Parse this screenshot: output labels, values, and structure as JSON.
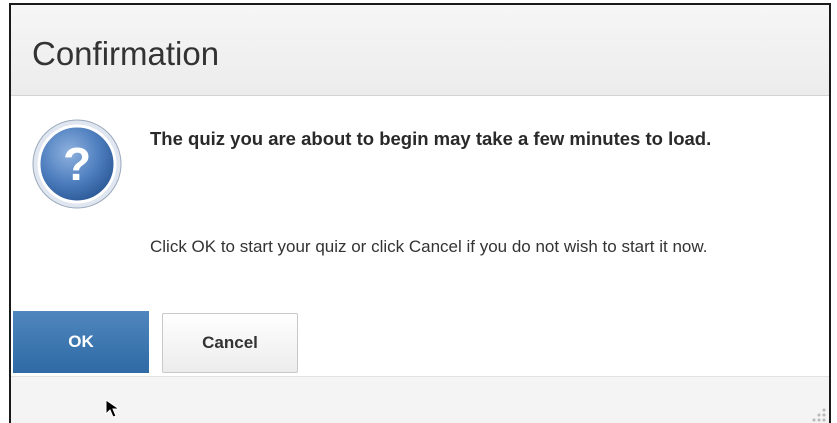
{
  "dialog": {
    "title": "Confirmation",
    "message_primary": "The quiz you are about to begin may take a few minutes to load.",
    "message_secondary": "Click OK to start your quiz or click Cancel if you do not wish to start it now.",
    "icon": "question-mark-icon",
    "buttons": {
      "ok_label": "OK",
      "cancel_label": "Cancel"
    }
  },
  "colors": {
    "primary_button": "#3a74ae",
    "icon_fill": "#5b86c0",
    "titlebar_bg": "#f2f2f2",
    "footer_bg": "#f4f4f4"
  }
}
